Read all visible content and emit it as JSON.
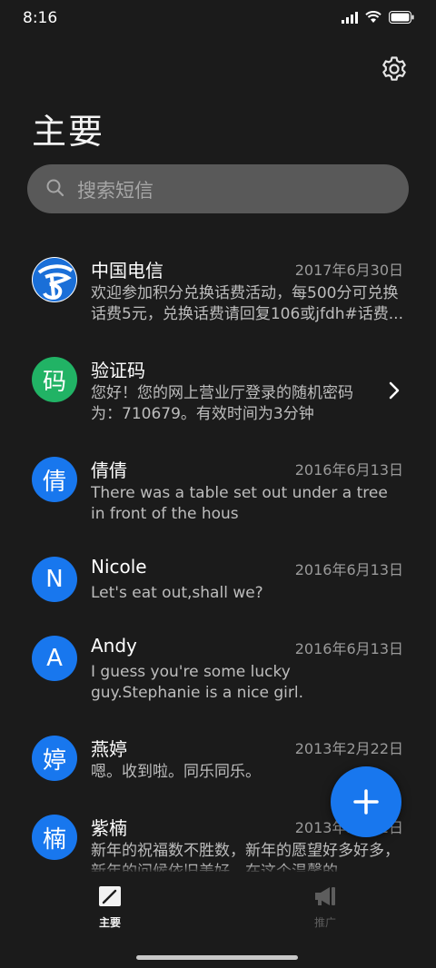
{
  "status_bar": {
    "time": "8:16"
  },
  "header": {
    "title": "主要"
  },
  "search": {
    "placeholder": "搜索短信"
  },
  "conversations": [
    {
      "avatar_icon": "china-telecom-logo",
      "avatar_color": "#1a6fd8",
      "name": "中国电信",
      "date": "2017年6月30日",
      "preview": "欢迎参加积分兑换话费活动，每500分可兑换话费5元，兑换话费请回复106或jfdh#话费..."
    },
    {
      "avatar": "码",
      "avatar_color": "#21b365",
      "name": "验证码",
      "date": "",
      "preview": "您好！您的网上营业厅登录的随机密码为：710679。有效时间为3分钟"
    },
    {
      "avatar": "倩",
      "avatar_color": "#1877ee",
      "name": "倩倩",
      "date": "2016年6月13日",
      "preview": "There was a table set out under a tree in front of the hous"
    },
    {
      "avatar": "N",
      "avatar_color": "#1877ee",
      "name": "Nicole",
      "date": "2016年6月13日",
      "preview": "Let's eat out,shall we?"
    },
    {
      "avatar": "A",
      "avatar_color": "#1877ee",
      "name": "Andy",
      "date": "2016年6月13日",
      "preview": "I guess you're some lucky guy.Stephanie is a nice girl."
    },
    {
      "avatar": "婷",
      "avatar_color": "#1877ee",
      "name": "燕婷",
      "date": "2013年2月22日",
      "preview": "嗯。收到啦。同乐同乐。"
    },
    {
      "avatar": "楠",
      "avatar_color": "#1877ee",
      "name": "紫楠",
      "date": "2013年2月22日",
      "preview": "新年的祝福数不胜数，新年的愿望好多好多，新年的问候依旧美好，在这个温馨的..."
    }
  ],
  "fab": {
    "icon": "plus-icon",
    "color": "#1877ee"
  },
  "bottom_nav": [
    {
      "label": "主要",
      "icon": "compose-icon",
      "active": true
    },
    {
      "label": "推广",
      "icon": "megaphone-icon",
      "active": false
    }
  ]
}
